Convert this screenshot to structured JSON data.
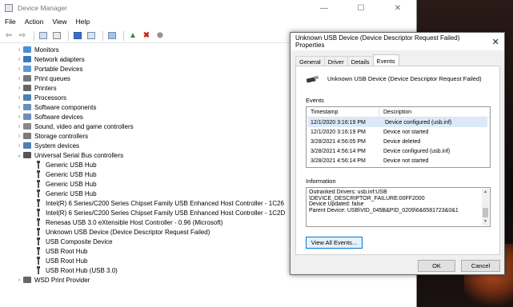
{
  "device_manager": {
    "title": "Device Manager",
    "window_controls": [
      "—",
      "☐",
      "✕"
    ],
    "menu": [
      "File",
      "Action",
      "View",
      "Help"
    ],
    "tree": [
      {
        "level": 0,
        "expander": "›",
        "label": "Monitors",
        "icon_color": "#4a90d9"
      },
      {
        "level": 0,
        "expander": "›",
        "label": "Network adapters",
        "icon_color": "#3a78c2"
      },
      {
        "level": 0,
        "expander": "›",
        "label": "Portable Devices",
        "icon_color": "#5a9bd5"
      },
      {
        "level": 0,
        "expander": "›",
        "label": "Print queues",
        "icon_color": "#777777"
      },
      {
        "level": 0,
        "expander": "›",
        "label": "Printers",
        "icon_color": "#666666"
      },
      {
        "level": 0,
        "expander": "›",
        "label": "Processors",
        "icon_color": "#4f7fb3"
      },
      {
        "level": 0,
        "expander": "›",
        "label": "Software components",
        "icon_color": "#6d8fb5"
      },
      {
        "level": 0,
        "expander": "›",
        "label": "Software devices",
        "icon_color": "#6d8fb5"
      },
      {
        "level": 0,
        "expander": "›",
        "label": "Sound, video and game controllers",
        "icon_color": "#888888"
      },
      {
        "level": 0,
        "expander": "›",
        "label": "Storage controllers",
        "icon_color": "#7a7a7a"
      },
      {
        "level": 0,
        "expander": "›",
        "label": "System devices",
        "icon_color": "#4f7fb3"
      },
      {
        "level": 0,
        "expander": "⌄",
        "label": "Universal Serial Bus controllers",
        "icon_color": "#555555"
      },
      {
        "level": 1,
        "label": "Generic USB Hub"
      },
      {
        "level": 1,
        "label": "Generic USB Hub"
      },
      {
        "level": 1,
        "label": "Generic USB Hub"
      },
      {
        "level": 1,
        "label": "Generic USB Hub"
      },
      {
        "level": 1,
        "label": "Intel(R) 6 Series/C200 Series Chipset Family USB Enhanced Host Controller - 1C26"
      },
      {
        "level": 1,
        "label": "Intel(R) 6 Series/C200 Series Chipset Family USB Enhanced Host Controller - 1C2D"
      },
      {
        "level": 1,
        "label": "Renesas USB 3.0 eXtensible Host Controller - 0.96 (Microsoft)"
      },
      {
        "level": 1,
        "label": "Unknown USB Device (Device Descriptor Request Failed)"
      },
      {
        "level": 1,
        "label": "USB Composite Device"
      },
      {
        "level": 1,
        "label": "USB Root Hub"
      },
      {
        "level": 1,
        "label": "USB Root Hub"
      },
      {
        "level": 1,
        "label": "USB Root Hub (USB 3.0)"
      },
      {
        "level": 0,
        "expander": "›",
        "label": "WSD Print Provider",
        "icon_color": "#666666"
      }
    ]
  },
  "properties": {
    "title": "Unknown USB Device (Device Descriptor Request Failed) Properties",
    "close": "✕",
    "tabs": [
      "General",
      "Driver",
      "Details",
      "Events"
    ],
    "active_tab": "Events",
    "device_name": "Unknown USB Device (Device Descriptor Request Failed)",
    "events_label": "Events",
    "col_timestamp": "Timestamp",
    "col_description": "Description",
    "events": [
      {
        "timestamp": "12/1/2020 3:16:19 PM",
        "description": "Device configured (usb.inf)",
        "selected": true
      },
      {
        "timestamp": "12/1/2020 3:16:19 PM",
        "description": "Device not started"
      },
      {
        "timestamp": "3/28/2021 4:56:05 PM",
        "description": "Device deleted"
      },
      {
        "timestamp": "3/28/2021 4:56:14 PM",
        "description": "Device configured (usb.inf)"
      },
      {
        "timestamp": "3/28/2021 4:56:14 PM",
        "description": "Device not started"
      }
    ],
    "information_label": "Information",
    "information_lines": [
      "Outranked Drivers: usb.inf:USB",
      "\\DEVICE_DESCRIPTOR_FAILURE:00FF2000",
      "Device Updated: false",
      "Parent Device: USB\\VID_045B&PID_0209\\6&6581723&0&1"
    ],
    "view_all_events": "View All Events...",
    "ok": "OK",
    "cancel": "Cancel"
  }
}
